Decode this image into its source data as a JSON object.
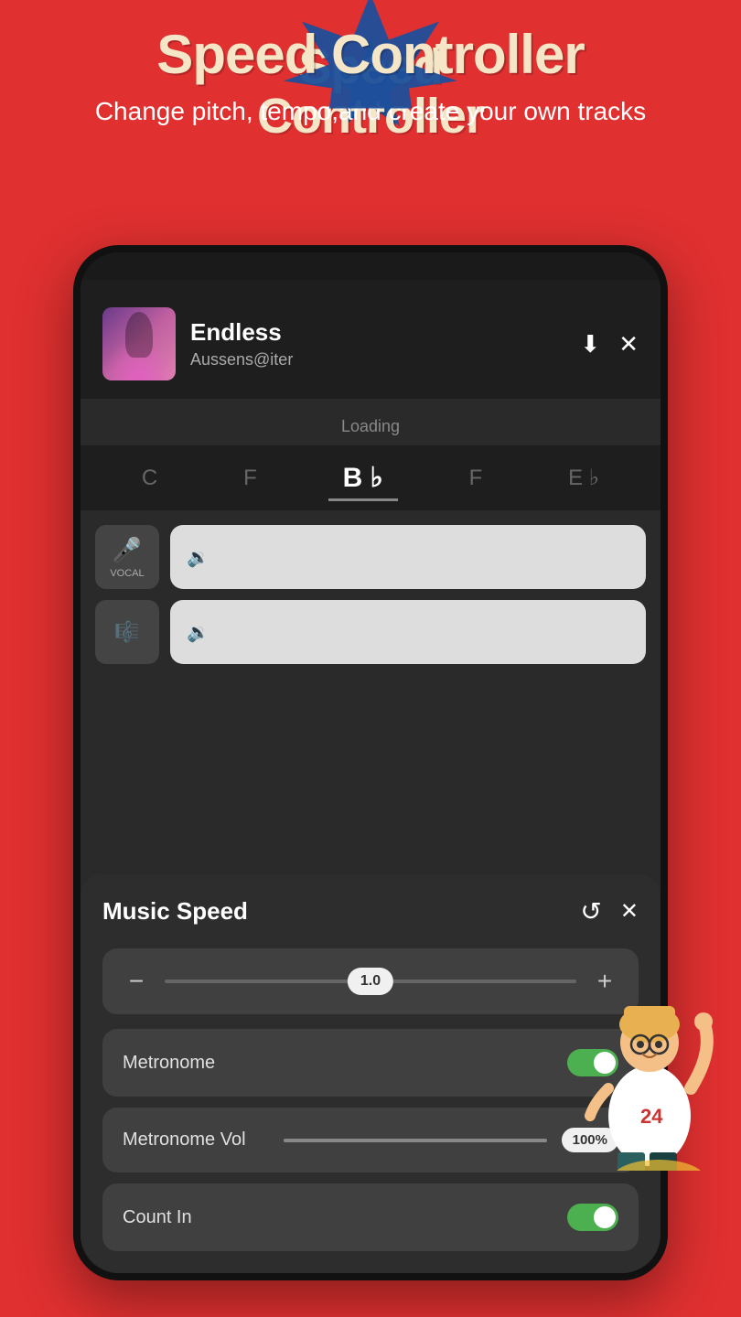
{
  "header": {
    "badge_text": "Speed Controller",
    "subtitle": "Change pitch, tempo,and create your own tracks"
  },
  "track": {
    "title": "Endless",
    "artist": "Aussens@iter",
    "loading_text": "Loading",
    "download_icon": "⬇",
    "close_icon": "✕"
  },
  "keys": [
    {
      "label": "C",
      "active": false
    },
    {
      "label": "F",
      "active": false
    },
    {
      "label": "B♭",
      "active": true
    },
    {
      "label": "F",
      "active": false
    },
    {
      "label": "E♭",
      "active": false
    }
  ],
  "tracks": [
    {
      "type": "VOCAL",
      "icon": "🎤"
    },
    {
      "type": "MUSIC",
      "icon": "🎼"
    }
  ],
  "speed_panel": {
    "title": "Music Speed",
    "refresh_icon": "↺",
    "close_icon": "✕",
    "speed_value": "1.0",
    "minus_label": "−",
    "plus_label": "+"
  },
  "metronome": {
    "label": "Metronome",
    "enabled": true
  },
  "metronome_vol": {
    "label": "Metronome Vol",
    "value": "100%"
  },
  "count_in": {
    "label": "Count In",
    "enabled": true
  }
}
